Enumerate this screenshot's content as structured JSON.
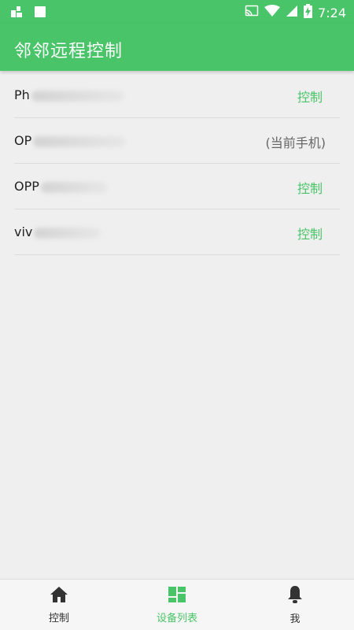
{
  "colors": {
    "accent": "#4ac468",
    "background": "#efefef"
  },
  "status_bar": {
    "time": "7:24",
    "icons": [
      "app-notification-icon",
      "stop-icon",
      "cast-icon",
      "wifi-icon",
      "signal-icon",
      "battery-charging-icon"
    ]
  },
  "app_bar": {
    "title": "邻邻远程控制"
  },
  "devices": [
    {
      "name_prefix": "Ph",
      "action": "控制"
    },
    {
      "name_prefix": "OP",
      "action": "(当前手机)"
    },
    {
      "name_prefix": "OPP",
      "action": "控制"
    },
    {
      "name_prefix": "viv",
      "action": "控制"
    }
  ],
  "tabs": [
    {
      "label": "控制",
      "icon": "home-icon",
      "active": false
    },
    {
      "label": "设备列表",
      "icon": "dashboard-icon",
      "active": true
    },
    {
      "label": "我",
      "icon": "bell-icon",
      "active": false
    }
  ]
}
